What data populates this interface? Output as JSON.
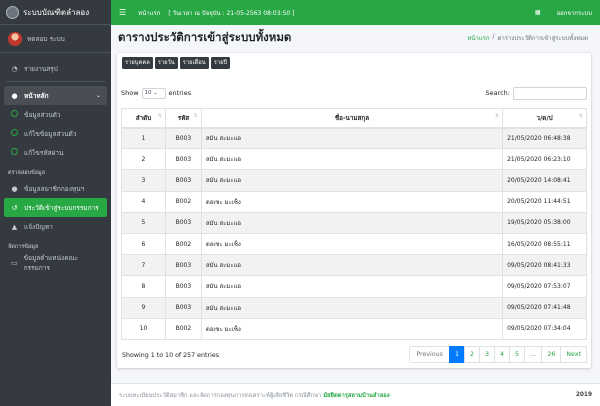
{
  "brand": {
    "title": "ระบบบัณฑิตลำลอง"
  },
  "user": {
    "name": "ทดสอบ ระบบ"
  },
  "sidebar": {
    "report": "รายงานสรุป",
    "main_menu": "หน้าหลัก",
    "sub_items": [
      "ข้อมูลส่วนตัว",
      "แก้ไขข้อมูลส่วนตัว",
      "แก้ไขรหัสผ่าน"
    ],
    "section_check": "ตรวจสอบข้อมูล",
    "check_items": [
      "ข้อมูลสมาชิกกองทุนฯ",
      "ประวัติเข้าสู่ระบบกรรมการ",
      "แจ้งปัญหา"
    ],
    "section_manage": "จัดการข้อมูล",
    "manage_items": [
      "ข้อมูลตำแหน่งคณะกรรมการ"
    ]
  },
  "topbar": {
    "home": "หน้าแรก",
    "datetime": "[ วันเวลา ณ ปัจจุบัน : 21-05-2563 08:03:50 ]",
    "logout": "ออกจากระบบ"
  },
  "header": {
    "title": "ตารางประวัติการเข้าสู่ระบบทั้งหมด",
    "crumb_home": "หน้าแรก",
    "crumb_sep": "/",
    "crumb_current": "ตารางประวัติการเข้าสู่ระบบทั้งหมด"
  },
  "buttons": [
    "รายบุคคล",
    "รายวัน",
    "รายเดือน",
    "รายปี"
  ],
  "controls": {
    "show": "Show",
    "length": "10",
    "entries": "entries",
    "search": "Search:"
  },
  "table": {
    "columns": [
      "ลำดับ",
      "รหัส",
      "ชื่อ-นามสกุล",
      "ว/ด/ป"
    ],
    "rows": [
      [
        "1",
        "B003",
        "สมัน สะมะแอ",
        "21/05/2020 06:48:38"
      ],
      [
        "2",
        "B003",
        "สมัน สะมะแอ",
        "21/05/2020 06:23:10"
      ],
      [
        "3",
        "B003",
        "สมัน สะมะแอ",
        "20/05/2020 14:08:41"
      ],
      [
        "4",
        "B002",
        "ดอเซะ มะเซ็ง",
        "20/05/2020 11:44:51"
      ],
      [
        "5",
        "B003",
        "สมัน สะมะแอ",
        "19/05/2020 05:38:00"
      ],
      [
        "6",
        "B002",
        "ดอเซะ มะเซ็ง",
        "16/05/2020 08:55:11"
      ],
      [
        "7",
        "B003",
        "สมัน สะมะแอ",
        "09/05/2020 08:41:33"
      ],
      [
        "8",
        "B003",
        "สมัน สะมะแอ",
        "09/05/2020 07:53:07"
      ],
      [
        "9",
        "B003",
        "สมัน สะมะแอ",
        "09/05/2020 07:41:48"
      ],
      [
        "10",
        "B002",
        "ดอเซะ มะเซ็ง",
        "09/05/2020 07:34:04"
      ]
    ]
  },
  "info": "Showing 1 to 10 of 257 entries",
  "pager": {
    "prev": "Previous",
    "pages": [
      "1",
      "2",
      "3",
      "4",
      "5",
      "…",
      "26"
    ],
    "next": "Next",
    "active": "1"
  },
  "footer": {
    "text": "ระบบทะเบียนประวัติสมาชิก และจัดการกองทุนการสงเคราะห์ผู้เสียชีวิต กรณีศึกษา",
    "link": "มัสยิดดารุสลามบ้านลำลอง",
    "dot": ".",
    "year": "2019"
  },
  "colors": {
    "accent": "#28a745",
    "sidebar": "#343a40",
    "page_active": "#007bff"
  }
}
